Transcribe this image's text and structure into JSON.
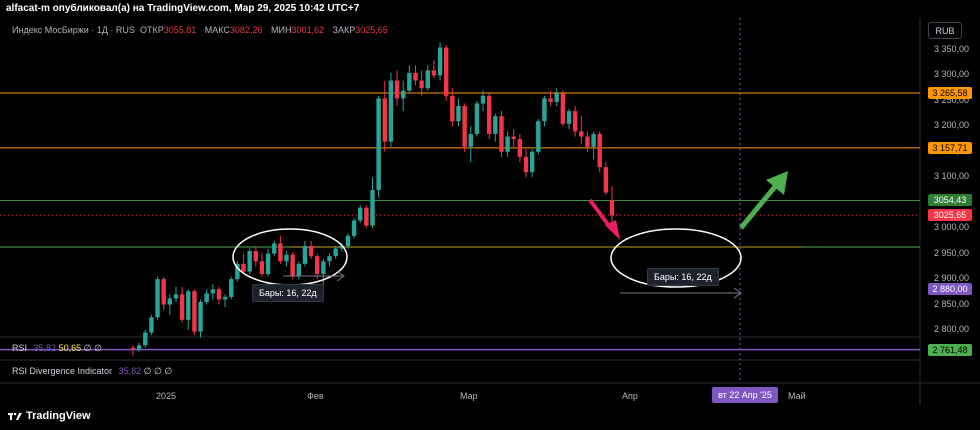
{
  "header": {
    "publisher_line": "alfacat-m опубликовал(а) на TradingView.com, Мар 29, 2025 10:42 UTC+7"
  },
  "legend": {
    "symbol": "Индекс МосБиржи · 1Д · RUS",
    "open_label": "ОТКР",
    "open_value": "3055,81",
    "high_label": "МАКС",
    "high_value": "3082,26",
    "low_label": "МИН",
    "low_value": "3001,62",
    "close_label": "ЗАКР",
    "close_value": "3025,65"
  },
  "currency_button": "RUB",
  "price_axis": [
    "3 350,00",
    "3 300,00",
    "3 250,00",
    "3 200,00",
    "3 150,00",
    "3 100,00",
    "3 050,00",
    "3 000,00",
    "2 950,00",
    "2 900,00",
    "2 850,00",
    "2 800,00"
  ],
  "price_labels": [
    {
      "text": "3 265,58",
      "color": "#ff9800",
      "text_color": "#000000"
    },
    {
      "text": "3 157,71",
      "color": "#ff9800",
      "text_color": "#000000"
    },
    {
      "text": "3054,43",
      "color": "#2e7d32",
      "text_color": "#ffffff"
    },
    {
      "text": "3025,65",
      "color": "#f23645",
      "text_color": "#ffffff"
    },
    {
      "text": "2 880,00",
      "color": "#7e57c2",
      "text_color": "#ffffff"
    },
    {
      "text": "2 761,48",
      "color": "#4caf50",
      "text_color": "#000000"
    }
  ],
  "indicators": {
    "rsi": {
      "name": "RSI",
      "v1": "35,82",
      "v2": "50,65",
      "v3": "∅",
      "v4": "∅"
    },
    "rsi_div": {
      "name": "RSI Divergence Indicator",
      "v1": "35,82",
      "v2": "∅",
      "v3": "∅",
      "v4": "∅"
    }
  },
  "time_axis": {
    "y2025": "2025",
    "feb": "Фев",
    "mar": "Мар",
    "apr": "Апр",
    "may": "Май",
    "cursor_date": "вт 22 Апр '25"
  },
  "annotations": {
    "bars_left": "Бары: 16, 22д",
    "bars_right": "Бары: 16, 22д"
  },
  "footer": {
    "brand": "TradingView"
  },
  "colors": {
    "up": "#26a69a",
    "down": "#f23645",
    "orange": "#ff9800",
    "green_line": "#4caf50",
    "purple": "#7e57c2"
  },
  "chart_data": {
    "type": "candlestick",
    "ylim": [
      2740,
      3380
    ],
    "candles": [
      [
        2765,
        2770,
        2750,
        2762
      ],
      [
        2762,
        2775,
        2758,
        2770
      ],
      [
        2770,
        2800,
        2765,
        2795
      ],
      [
        2795,
        2830,
        2790,
        2825
      ],
      [
        2825,
        2905,
        2820,
        2900
      ],
      [
        2900,
        2905,
        2840,
        2850
      ],
      [
        2850,
        2870,
        2830,
        2862
      ],
      [
        2862,
        2885,
        2855,
        2870
      ],
      [
        2870,
        2885,
        2815,
        2820
      ],
      [
        2820,
        2880,
        2800,
        2876
      ],
      [
        2876,
        2880,
        2790,
        2797
      ],
      [
        2797,
        2860,
        2785,
        2855
      ],
      [
        2855,
        2880,
        2850,
        2872
      ],
      [
        2872,
        2890,
        2860,
        2880
      ],
      [
        2880,
        2885,
        2850,
        2860
      ],
      [
        2860,
        2870,
        2845,
        2865
      ],
      [
        2865,
        2905,
        2860,
        2900
      ],
      [
        2900,
        2935,
        2895,
        2930
      ],
      [
        2930,
        2950,
        2910,
        2915
      ],
      [
        2915,
        2960,
        2910,
        2955
      ],
      [
        2955,
        2965,
        2925,
        2935
      ],
      [
        2935,
        2950,
        2905,
        2910
      ],
      [
        2910,
        2960,
        2905,
        2950
      ],
      [
        2950,
        2975,
        2945,
        2970
      ],
      [
        2970,
        2985,
        2930,
        2935
      ],
      [
        2935,
        2955,
        2925,
        2948
      ],
      [
        2948,
        2952,
        2900,
        2905
      ],
      [
        2905,
        2935,
        2900,
        2930
      ],
      [
        2930,
        2975,
        2925,
        2965
      ],
      [
        2965,
        2975,
        2940,
        2945
      ],
      [
        2945,
        2950,
        2900,
        2910
      ],
      [
        2910,
        2940,
        2890,
        2935
      ],
      [
        2935,
        2950,
        2925,
        2945
      ],
      [
        2945,
        2965,
        2940,
        2960
      ],
      [
        2960,
        2970,
        2955,
        2965
      ],
      [
        2965,
        2990,
        2960,
        2985
      ],
      [
        2985,
        3020,
        2980,
        3015
      ],
      [
        3015,
        3045,
        3010,
        3040
      ],
      [
        3040,
        3045,
        3000,
        3005
      ],
      [
        3005,
        3100,
        3000,
        3075
      ],
      [
        3075,
        3260,
        3060,
        3255
      ],
      [
        3255,
        3290,
        3150,
        3170
      ],
      [
        3170,
        3305,
        3160,
        3290
      ],
      [
        3290,
        3310,
        3240,
        3255
      ],
      [
        3255,
        3290,
        3230,
        3270
      ],
      [
        3270,
        3320,
        3265,
        3305
      ],
      [
        3305,
        3320,
        3280,
        3290
      ],
      [
        3290,
        3310,
        3260,
        3275
      ],
      [
        3275,
        3320,
        3270,
        3310
      ],
      [
        3310,
        3330,
        3295,
        3300
      ],
      [
        3300,
        3365,
        3290,
        3355
      ],
      [
        3355,
        3360,
        3250,
        3260
      ],
      [
        3260,
        3275,
        3200,
        3210
      ],
      [
        3210,
        3255,
        3200,
        3240
      ],
      [
        3240,
        3245,
        3150,
        3160
      ],
      [
        3160,
        3200,
        3130,
        3185
      ],
      [
        3185,
        3250,
        3180,
        3245
      ],
      [
        3245,
        3270,
        3230,
        3260
      ],
      [
        3260,
        3265,
        3175,
        3185
      ],
      [
        3185,
        3225,
        3170,
        3220
      ],
      [
        3220,
        3230,
        3140,
        3150
      ],
      [
        3150,
        3190,
        3140,
        3180
      ],
      [
        3180,
        3195,
        3160,
        3175
      ],
      [
        3175,
        3185,
        3130,
        3140
      ],
      [
        3140,
        3155,
        3100,
        3110
      ],
      [
        3110,
        3155,
        3100,
        3150
      ],
      [
        3150,
        3215,
        3145,
        3210
      ],
      [
        3210,
        3260,
        3200,
        3255
      ],
      [
        3255,
        3270,
        3240,
        3248
      ],
      [
        3248,
        3275,
        3240,
        3265
      ],
      [
        3265,
        3270,
        3200,
        3205
      ],
      [
        3205,
        3235,
        3195,
        3230
      ],
      [
        3230,
        3240,
        3180,
        3190
      ],
      [
        3190,
        3220,
        3165,
        3180
      ],
      [
        3180,
        3190,
        3150,
        3160
      ],
      [
        3160,
        3190,
        3135,
        3185
      ],
      [
        3185,
        3190,
        3110,
        3120
      ],
      [
        3120,
        3130,
        3065,
        3070
      ],
      [
        3055,
        3082,
        3001,
        3025
      ]
    ],
    "horizontal_levels": [
      3265.58,
      3157.71,
      3054.43,
      2880.0,
      2761.48,
      2963
    ]
  }
}
